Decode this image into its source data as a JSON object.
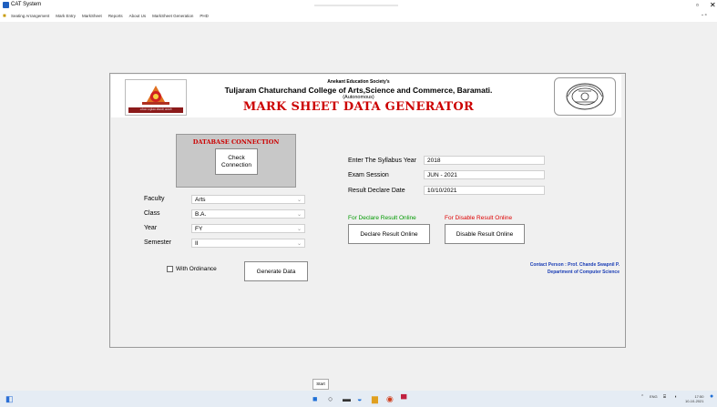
{
  "window": {
    "title": "CAT System",
    "minimize_glyph": "▫",
    "close_glyph": "✕"
  },
  "menu": {
    "items": [
      "Seating Arrangement",
      "Mark Entry",
      "MarkSheet",
      "Reports",
      "About Us",
      "MarkSheet Generation",
      "PHD"
    ],
    "right_glyph": "- ▫"
  },
  "header": {
    "society": "Anekant Education Society's",
    "college": "Tuljaram Chaturchand College of Arts,Science and Commerce, Baramati.",
    "autonomous": "(Autonomous)",
    "title": "MARK SHEET DATA GENERATOR",
    "logo_left_caption": "अनेकांत एज्युकेशन सोसायटी, बारामती"
  },
  "database": {
    "label": "DATABASE CONNECTION",
    "check_button": "Check\nConnection"
  },
  "form": {
    "faculty_label": "Faculty",
    "faculty_value": "Arts",
    "class_label": "Class",
    "class_value": "B.A.",
    "year_label": "Year",
    "year_value": "FY",
    "semester_label": "Semester",
    "semester_value": "II",
    "with_ordinance": "With Ordinance",
    "generate_button": "Generate Data"
  },
  "exam": {
    "syllabus_label": "Enter The Syllabus Year",
    "syllabus_value": "2018",
    "session_label": "Exam Session",
    "session_value": "JUN - 2021",
    "declare_date_label": "Result Declare Date",
    "declare_date_value": "10/10/2021"
  },
  "online": {
    "declare_label": "For Declare Result Online",
    "disable_label": "For Disable Result Online",
    "declare_button": "Declare Result Online",
    "disable_button": "Disable Result Online"
  },
  "contact": {
    "line1": "Contact Person : Prof. Chande Swapnil P.",
    "line2": "Department of Computer Science"
  },
  "start_button": "Start",
  "taskbar": {
    "lang": "ENG",
    "time": "17:50",
    "date": "10-10-2021"
  },
  "colors": {
    "title_red": "#cc0000",
    "online_green": "#009900",
    "contact_blue": "#1a3db5"
  }
}
